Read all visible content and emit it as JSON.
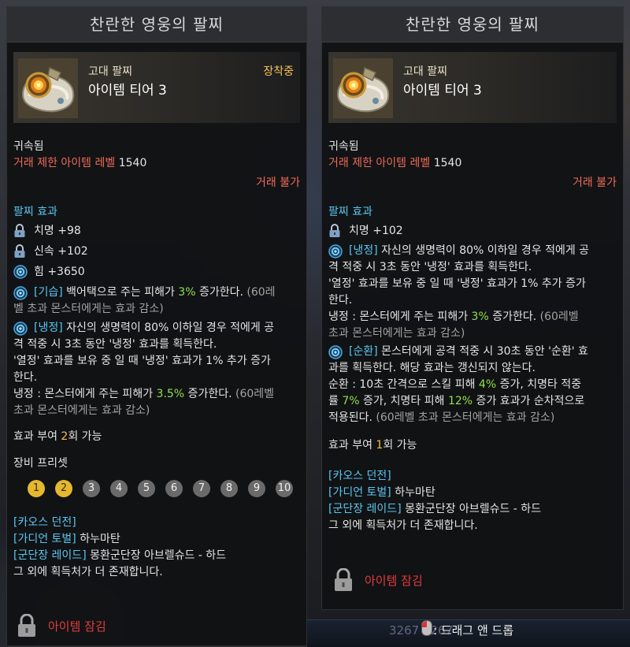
{
  "background": {
    "score_text": "3267  3267",
    "drag_text": ": 드래그 앤 드롭"
  },
  "left": {
    "title": "찬란한 영웅의 팔찌",
    "grade": "고대 팔찌",
    "tier": "아이템 티어 3",
    "equipped": "장착중",
    "bound": "귀속됨",
    "trade_level_label": "거래 제한 아이템 레벨",
    "trade_level_value": "1540",
    "trade_impossible": "거래 불가",
    "effect_header": "팔찌 효과",
    "stats": [
      {
        "icon": "lock-icon",
        "text": "치명 +98"
      },
      {
        "icon": "lock-icon",
        "text": "신속 +102"
      },
      {
        "icon": "engrave-icon",
        "text": "힘 +3650"
      }
    ],
    "gisup": {
      "tag": "[기습]",
      "pre": " 백어택으로 주는 피해가 ",
      "val": "3%",
      "post": " 증가한다.",
      "note1": " (60레",
      "note2": "벨 초과 몬스터에게는 효과 감소)"
    },
    "naengjeong": {
      "tag": "[냉정]",
      "l1": " 자신의 생명력이 80% 이하일 경우 적에게 공",
      "l2": "격 적중 시 3초 동안 '냉정' 효과를 획득한다.",
      "l3": "'열정' 효과를 보유 중 일 때 '냉정' 효과가 1% 추가 증가",
      "l4": "한다.",
      "l5_pre": "냉정 : 몬스터에게 주는 피해가 ",
      "l5_val": "3.5%",
      "l5_post": " 증가한다.",
      "l5_note": " (60레벨",
      "l6_note": "초과 몬스터에게는 효과 감소)"
    },
    "grant_pre": "효과 부여 ",
    "grant_num": "2",
    "grant_post": "회 가능",
    "preset_label": "장비 프리셋",
    "presets": [
      "1",
      "2",
      "3",
      "4",
      "5",
      "6",
      "7",
      "8",
      "9",
      "10"
    ],
    "sources": [
      {
        "tag": "[카오스 던전]",
        "text": ""
      },
      {
        "tag": "[가디언 토벌]",
        "text": " 하누마탄"
      },
      {
        "tag": "[군단장 레이드]",
        "text": " 몽환군단장 아브렐슈드 - 하드"
      }
    ],
    "more_sources": "그 외에 획득처가 더 존재합니다.",
    "lock_text": "아이템 잠김"
  },
  "right": {
    "title": "찬란한 영웅의 팔찌",
    "grade": "고대 팔찌",
    "tier": "아이템 티어 3",
    "bound": "귀속됨",
    "trade_level_label": "거래 제한 아이템 레벨",
    "trade_level_value": "1540",
    "trade_impossible": "거래 불가",
    "effect_header": "팔찌 효과",
    "stats": [
      {
        "icon": "lock-icon",
        "text": "치명 +102"
      }
    ],
    "naengjeong": {
      "tag": "[냉정]",
      "l1": " 자신의 생명력이 80% 이하일 경우 적에게 공",
      "l2": "격 적중 시 3초 동안 '냉정' 효과를 획득한다.",
      "l3": "'열정' 효과를 보유 중 일 때 '냉정' 효과가 1% 추가 증가",
      "l4": "한다.",
      "l5_pre": "냉정 : 몬스터에게 주는 피해가 ",
      "l5_val": "3%",
      "l5_post": " 증가한다.",
      "l5_note": " (60레벨",
      "l6_note": "초과 몬스터에게는 효과 감소)"
    },
    "sunhwan": {
      "tag": "[순환]",
      "l1": " 몬스터에게 공격 적중 시 30초 동안 '순환' 효",
      "l2": "과를 획득한다. 해당 효과는 갱신되지 않는다.",
      "l3_pre": "순환 : 10초 간격으로 스킬 피해 ",
      "l3_v1": "4%",
      "l3_post": " 증가, 치명타 적중",
      "l4_pre": "률 ",
      "l4_v2": "7%",
      "l4_mid": " 증가, 치명타 피해 ",
      "l4_v3": "12%",
      "l4_post": " 증가 효과가 순차적으로",
      "l5": "적용된다.",
      "l5_note": " (60레벨 초과 몬스터에게는 효과 감소)"
    },
    "grant_pre": "효과 부여 ",
    "grant_num": "1",
    "grant_post": "회 가능",
    "sources": [
      {
        "tag": "[카오스 던전]",
        "text": ""
      },
      {
        "tag": "[가디언 토벌]",
        "text": " 하누마탄"
      },
      {
        "tag": "[군단장 레이드]",
        "text": " 몽환군단장 아브렐슈드 - 하드"
      }
    ],
    "more_sources": "그 외에 획득처가 더 존재합니다.",
    "lock_text": "아이템 잠김"
  },
  "colors": {
    "red": "#ef6b58",
    "blue": "#59c7f1",
    "green": "#8ee04d",
    "gold": "#f5bd44",
    "lock_red": "#e23c3c"
  }
}
